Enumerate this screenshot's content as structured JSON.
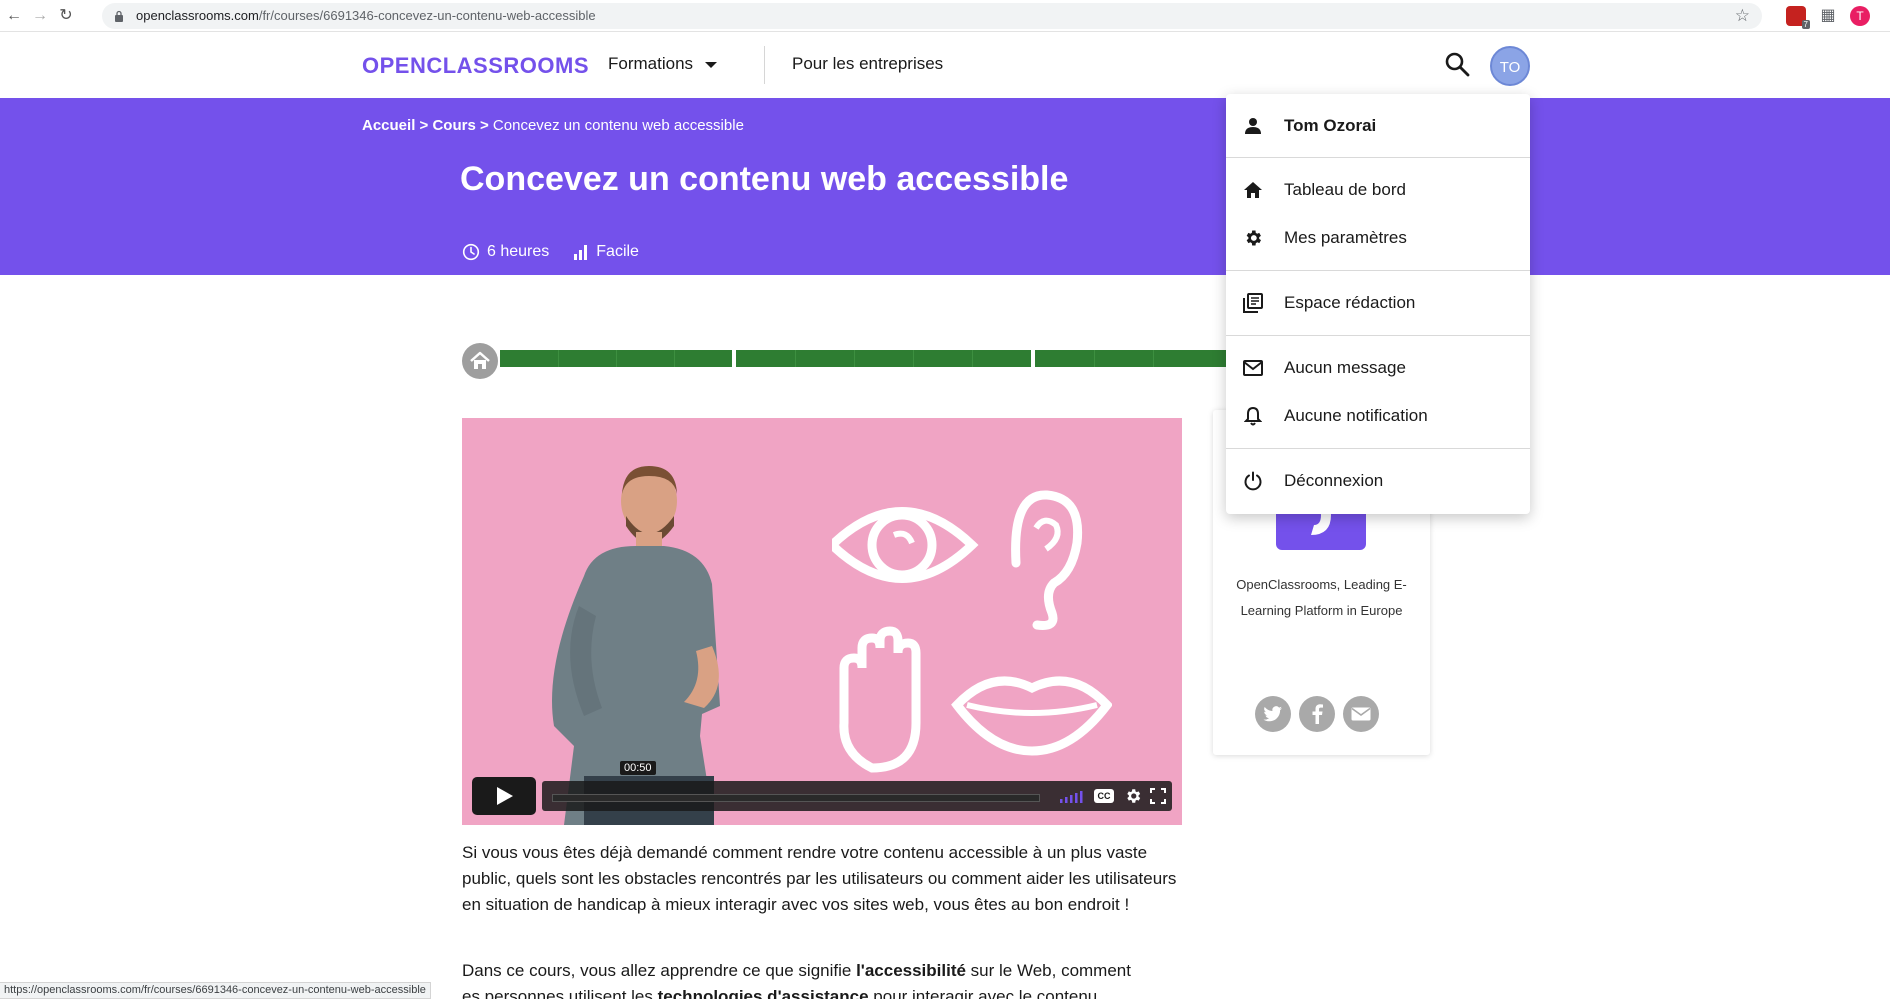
{
  "browser": {
    "url_host": "openclassrooms.com",
    "url_path": "/fr/courses/6691346-concevez-un-contenu-web-accessible",
    "extension_badge": "7",
    "profile_initial": "T"
  },
  "header": {
    "logo": "OPENCLASSROOMS",
    "nav_formations": "Formations",
    "nav_entreprises": "Pour les entreprises",
    "user_initials": "TO"
  },
  "hero": {
    "breadcrumb": {
      "home": "Accueil",
      "sep1": " > ",
      "courses": "Cours",
      "sep2": " > ",
      "current": "Concevez un contenu web accessible"
    },
    "title": "Concevez un contenu web accessible",
    "duration": "6 heures",
    "level": "Facile"
  },
  "video": {
    "time_tooltip": "00:50",
    "cc_label": "CC",
    "progress": 0
  },
  "content": {
    "p1": "Si vous vous êtes déjà demandé comment rendre votre contenu accessible à un plus vaste public, quels sont les obstacles rencontrés par les utilisateurs ou comment aider les utilisateurs en situation de handicap à mieux interagir avec vos sites web, vous êtes au bon endroit !",
    "p2_a": "Dans ce cours, vous allez apprendre ce que signifie ",
    "p2_b": "l'accessibilité",
    "p2_c": " sur le Web, comment ",
    "p2_d": "es personnes utilisent les ",
    "p2_e": "technologies d'assistance",
    "p2_f": " pour interagir avec le contenu"
  },
  "card": {
    "text": "OpenClassrooms, Leading E-Learning Platform in Europe"
  },
  "user_menu": {
    "name": "Tom Ozorai",
    "dashboard": "Tableau de bord",
    "settings": "Mes paramètres",
    "writing": "Espace rédaction",
    "messages": "Aucun message",
    "notifications": "Aucune notification",
    "logout": "Déconnexion"
  },
  "status_bar": "https://openclassrooms.com/fr/courses/6691346-concevez-un-contenu-web-accessible",
  "colors": {
    "brand": "#7451eb",
    "progress": "#2e7d32",
    "video_bg": "#f0a4c4"
  }
}
